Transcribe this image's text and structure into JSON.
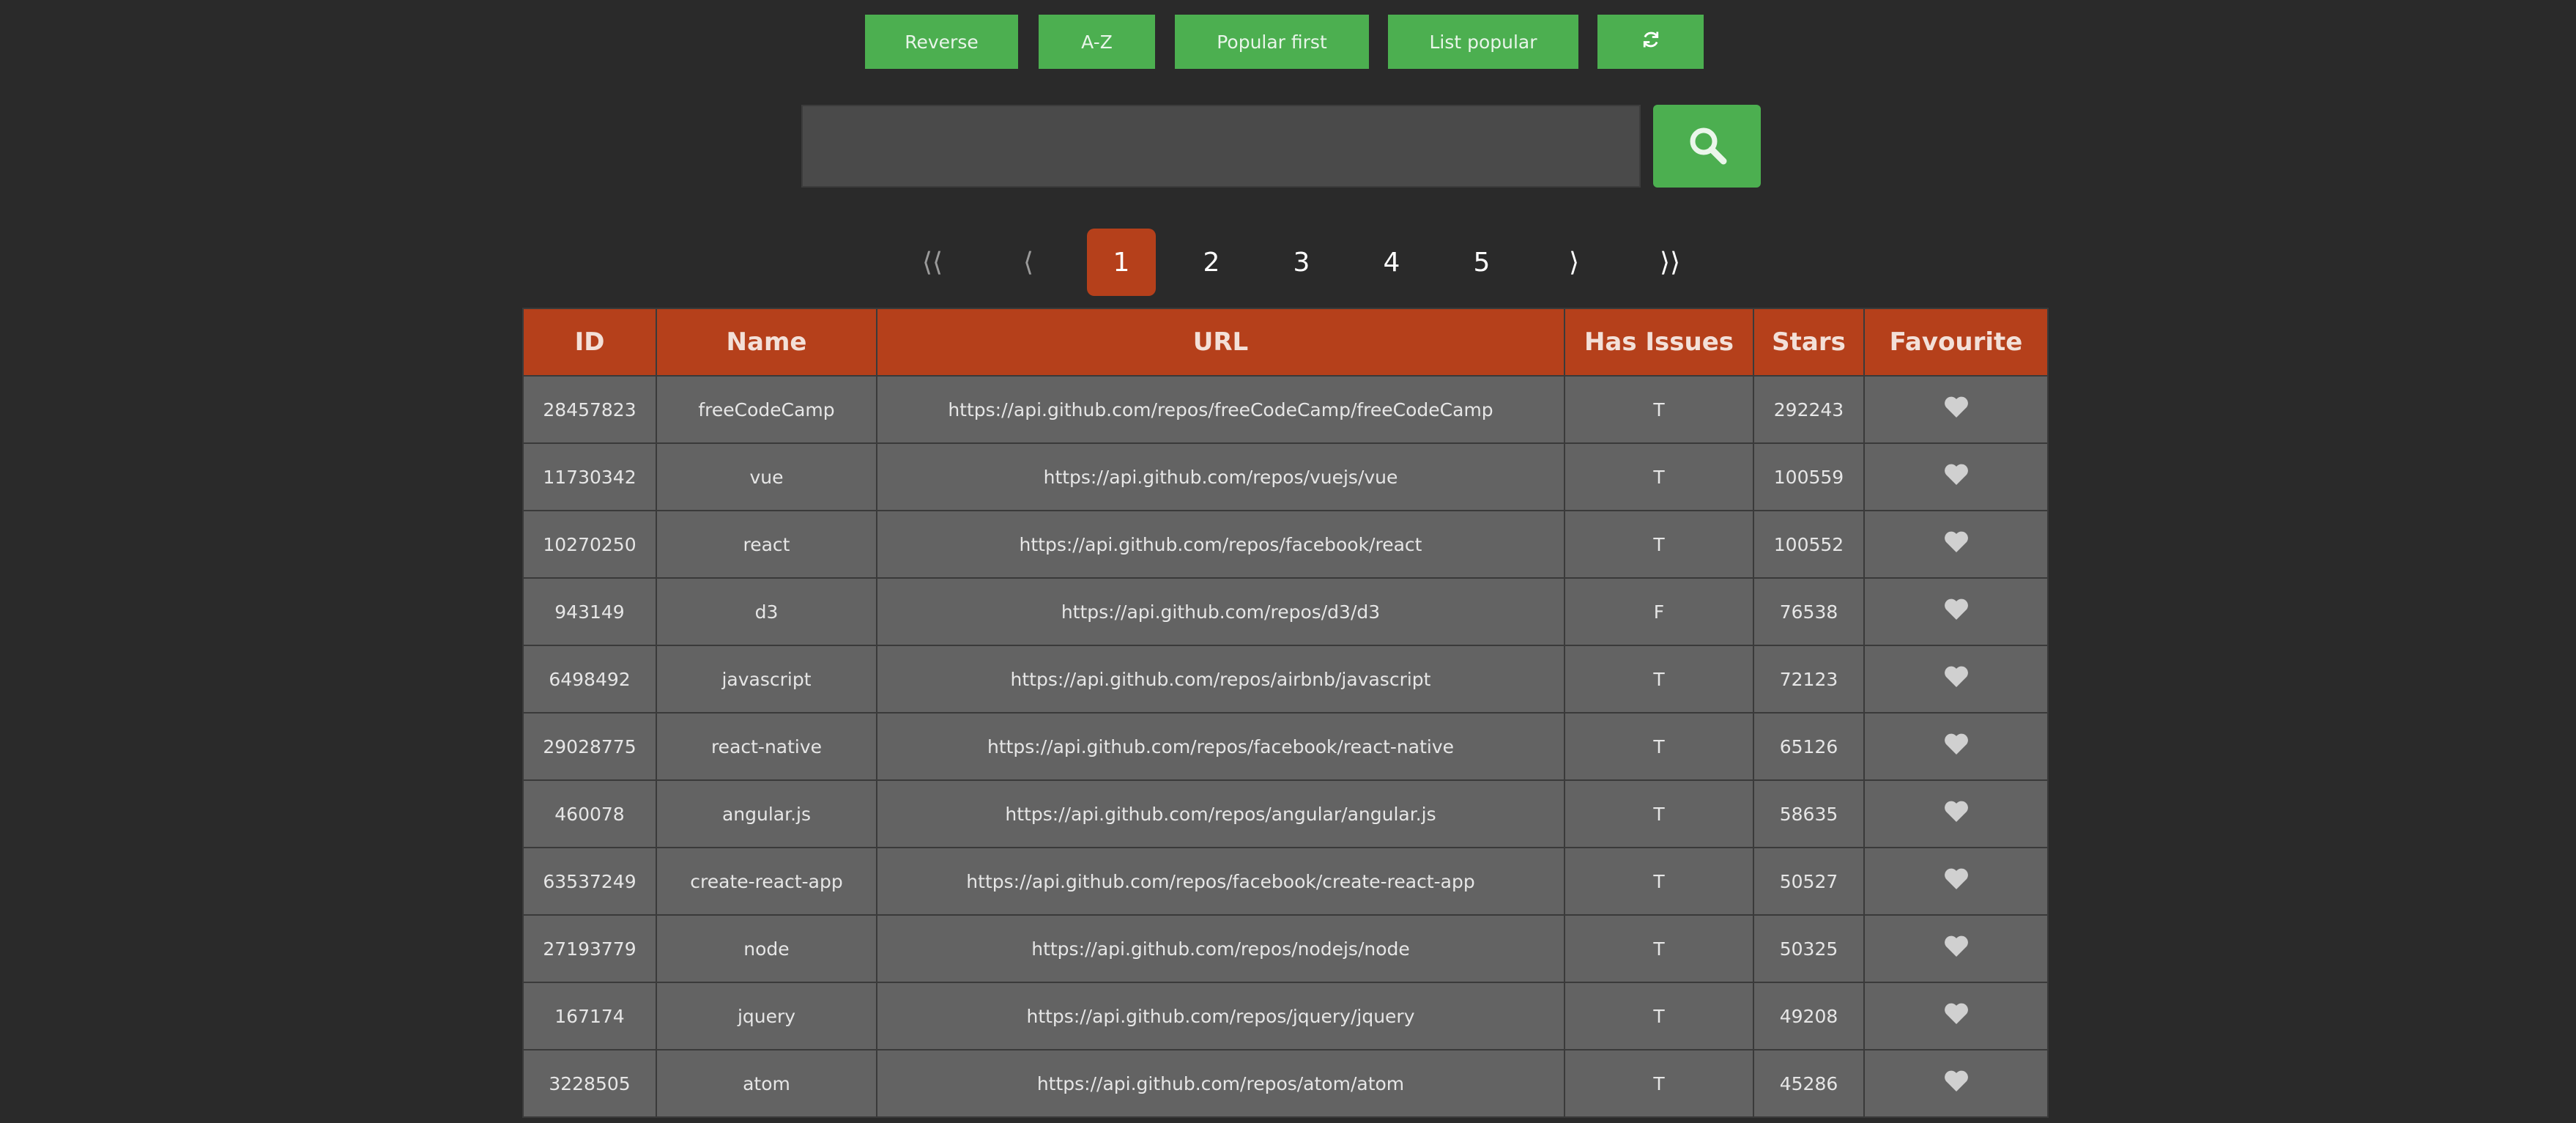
{
  "toolbar": {
    "reverse_label": "Reverse",
    "az_label": "A-Z",
    "popular_first_label": "Popular first",
    "list_popular_label": "List popular",
    "refresh_icon": "refresh-icon"
  },
  "search": {
    "value": "",
    "placeholder": "",
    "button_icon": "search-icon"
  },
  "pagination": {
    "first_label": "⟨⟨",
    "prev_label": "⟨",
    "pages": [
      "1",
      "2",
      "3",
      "4",
      "5"
    ],
    "current_page": "1",
    "next_label": "⟩",
    "last_label": "⟩⟩"
  },
  "table": {
    "columns": [
      "ID",
      "Name",
      "URL",
      "Has Issues",
      "Stars",
      "Favourite"
    ],
    "rows": [
      {
        "id": "28457823",
        "name": "freeCodeCamp",
        "url": "https://api.github.com/repos/freeCodeCamp/freeCodeCamp",
        "has_issues": "T",
        "stars": "292243",
        "favourite_icon": "heart-icon"
      },
      {
        "id": "11730342",
        "name": "vue",
        "url": "https://api.github.com/repos/vuejs/vue",
        "has_issues": "T",
        "stars": "100559",
        "favourite_icon": "heart-icon"
      },
      {
        "id": "10270250",
        "name": "react",
        "url": "https://api.github.com/repos/facebook/react",
        "has_issues": "T",
        "stars": "100552",
        "favourite_icon": "heart-icon"
      },
      {
        "id": "943149",
        "name": "d3",
        "url": "https://api.github.com/repos/d3/d3",
        "has_issues": "F",
        "stars": "76538",
        "favourite_icon": "heart-icon"
      },
      {
        "id": "6498492",
        "name": "javascript",
        "url": "https://api.github.com/repos/airbnb/javascript",
        "has_issues": "T",
        "stars": "72123",
        "favourite_icon": "heart-icon"
      },
      {
        "id": "29028775",
        "name": "react-native",
        "url": "https://api.github.com/repos/facebook/react-native",
        "has_issues": "T",
        "stars": "65126",
        "favourite_icon": "heart-icon"
      },
      {
        "id": "460078",
        "name": "angular.js",
        "url": "https://api.github.com/repos/angular/angular.js",
        "has_issues": "T",
        "stars": "58635",
        "favourite_icon": "heart-icon"
      },
      {
        "id": "63537249",
        "name": "create-react-app",
        "url": "https://api.github.com/repos/facebook/create-react-app",
        "has_issues": "T",
        "stars": "50527",
        "favourite_icon": "heart-icon"
      },
      {
        "id": "27193779",
        "name": "node",
        "url": "https://api.github.com/repos/nodejs/node",
        "has_issues": "T",
        "stars": "50325",
        "favourite_icon": "heart-icon"
      },
      {
        "id": "167174",
        "name": "jquery",
        "url": "https://api.github.com/repos/jquery/jquery",
        "has_issues": "T",
        "stars": "49208",
        "favourite_icon": "heart-icon"
      },
      {
        "id": "3228505",
        "name": "atom",
        "url": "https://api.github.com/repos/atom/atom",
        "has_issues": "T",
        "stars": "45286",
        "favourite_icon": "heart-icon"
      }
    ]
  },
  "colors": {
    "background": "#2a2a2a",
    "button_green": "#4caf50",
    "accent_orange": "#b5401b",
    "cell_gray": "#636363",
    "heart_gray": "#d0d0d0"
  }
}
